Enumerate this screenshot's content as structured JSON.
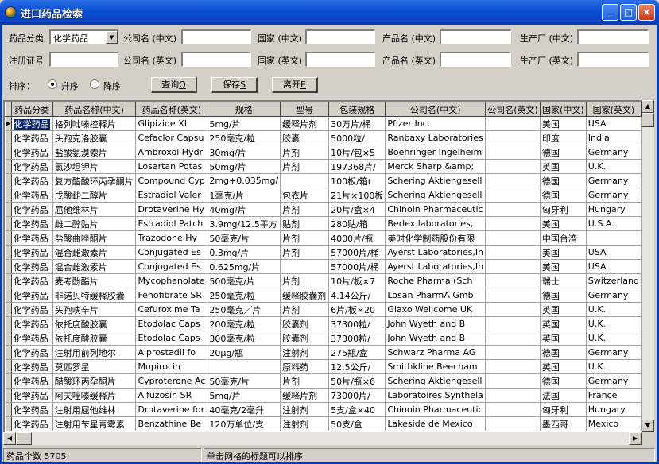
{
  "window": {
    "title": "进口药品检索",
    "minimize": "_",
    "maximize": "□",
    "close": "×"
  },
  "form": {
    "category_label": "药品分类",
    "category_value": "化学药品",
    "company_cn_label": "公司名 (中文)",
    "company_cn_value": "",
    "country_cn_label": "国家 (中文)",
    "country_cn_value": "",
    "product_cn_label": "产品名 (中文)",
    "product_cn_value": "",
    "maker_cn_label": "生产厂 (中文)",
    "maker_cn_value": "",
    "regno_label": "注册证号",
    "regno_value": "",
    "company_en_label": "公司名 (英文)",
    "company_en_value": "",
    "country_en_label": "国家 (英文)",
    "country_en_value": "",
    "product_en_label": "产品名 (英文)",
    "product_en_value": "",
    "maker_en_label": "生产厂 (英文)",
    "maker_en_value": "",
    "sort_label": "排序：",
    "asc_label": "升序",
    "desc_label": "降序",
    "sort_selected": "asc",
    "query_label": "查询",
    "query_key": "Q",
    "save_label": "保存",
    "save_key": "S",
    "exit_label": "离开",
    "exit_key": "E"
  },
  "grid": {
    "columns": [
      "药品分类",
      "药品名称(中文)",
      "药品名称(英文)",
      "规格",
      "型号",
      "包装规格",
      "公司名(中文)",
      "公司名(英文)",
      "国家(中文)",
      "国家(英文)"
    ],
    "rows": [
      [
        "化学药品",
        "格列吡嗪控释片",
        "Glipizide   XL",
        "5mg/片",
        "缓释片剂",
        "30万片/桶",
        "Pfizer   Inc.",
        "",
        "美国",
        "USA"
      ],
      [
        "化学药品",
        "头孢克洛胶囊",
        "Cefaclor   Capsu",
        "250毫克/粒",
        "胶囊",
        "5000粒/",
        "Ranbaxy   Laboratories",
        "",
        "印度",
        "India"
      ],
      [
        "化学药品",
        "盐酸氨溴索片",
        "Ambroxol   Hydr",
        "30mg/片",
        "片剂",
        "10片/包×5",
        "Boehringer   Ingelheim",
        "",
        "德国",
        "Germany"
      ],
      [
        "化学药品",
        "氯沙坦钾片",
        "Losartan   Potas",
        "50mg/片",
        "片剂",
        "197368片/",
        "Merck   Sharp   &amp;",
        "",
        "英国",
        "U.K."
      ],
      [
        "化学药品",
        "复方醋酸环丙孕酮片",
        "Compound   Cyp",
        "2mg+0.035mg/",
        "",
        "100板/箱(",
        "Schering   Aktiengesell",
        "",
        "德国",
        "Germany"
      ],
      [
        "化学药品",
        "戊酸雌二醇片",
        "Estradiol   Valer",
        "1毫克/片",
        "包衣片",
        "21片×100板",
        "Schering   Aktiengesell",
        "",
        "德国",
        "Germany"
      ],
      [
        "化学药品",
        "屈他维林片",
        "Drotaverine   Hy",
        "40mg/片",
        "片剂",
        "20片/盒×4",
        "Chinoin   Pharmaceutic",
        "",
        "匈牙利",
        "Hungary"
      ],
      [
        "化学药品",
        "雌二醇贴片",
        "Estradiol   Patch",
        "3.9mg/12.5平方",
        "贴剂",
        "280贴/箱",
        "Berlex   laboratories,",
        "",
        "美国",
        "U.S.A."
      ],
      [
        "化学药品",
        "盐酸曲唑酮片",
        "Trazodone   Hy",
        "50毫克/片",
        "片剂",
        "4000片/瓶",
        "美时化学制药股份有限",
        "",
        "中国台湾",
        ""
      ],
      [
        "化学药品",
        "混合雌激素片",
        "Conjugated   Es",
        "0.3mg/片",
        "片剂",
        "57000片/桶",
        "Ayerst   Laboratories,In",
        "",
        "美国",
        "USA"
      ],
      [
        "化学药品",
        "混合雌激素片",
        "Conjugated   Es",
        "0.625mg/片",
        "",
        "57000片/桶",
        "Ayerst   Laboratories,In",
        "",
        "美国",
        "USA"
      ],
      [
        "化学药品",
        "麦考酚酯片",
        "Mycophenolate",
        "500毫克/片",
        "片剂",
        "10片/板×7",
        "Roche   Pharma   (Sch",
        "",
        "瑞士",
        "Switzerland"
      ],
      [
        "化学药品",
        "非诺贝特缓释胶囊",
        "Fenofibrate   SR",
        "250毫克/粒",
        "缓释胶囊剂",
        "4.14公斤/",
        "Losan   PharmA   Gmb",
        "",
        "德国",
        "Germany"
      ],
      [
        "化学药品",
        "头孢呋辛片",
        "Cefuroxime   Ta",
        "250毫克／片",
        "片剂",
        "6片/板×20",
        "Glaxo   Wellcome   UK",
        "",
        "英国",
        "U.K."
      ],
      [
        "化学药品",
        "依托度酸胶囊",
        "Etodolac   Caps",
        "200毫克/粒",
        "胶囊剂",
        "37300粒/",
        "John   Wyeth   and   B",
        "",
        "英国",
        "U.K."
      ],
      [
        "化学药品",
        "依托度酸胶囊",
        "Etodolac   Caps",
        "300毫克/粒",
        "胶囊剂",
        "37300粒/",
        "John   Wyeth   and   B",
        "",
        "英国",
        "U.K."
      ],
      [
        "化学药品",
        "注射用前列地尔",
        "Alprostadil   fo",
        "20μg/瓶",
        "注射剂",
        "275瓶/盒",
        "Schwarz   Pharma   AG",
        "",
        "德国",
        "Germany"
      ],
      [
        "化学药品",
        "莫匹罗星",
        "Mupirocin",
        "",
        "原料药",
        "12.5公斤/",
        "Smithkline   Beecham",
        "",
        "英国",
        "U.K."
      ],
      [
        "化学药品",
        "醋酸环丙孕酮片",
        "Cyproterone   Ac",
        "50毫克/片",
        "片剂",
        "50片/瓶×6",
        "Schering   Aktiengesell",
        "",
        "德国",
        "Germany"
      ],
      [
        "化学药品",
        "阿夫唑嗪缓释片",
        "Alfuzosin   SR",
        "5mg/片",
        "缓释片剂",
        "73000片/",
        "Laboratoires   Synthela",
        "",
        "法国",
        "France"
      ],
      [
        "化学药品",
        "注射用屈他维林",
        "Drotaverine   for",
        "40毫克/2毫升",
        "注射剂",
        "5支/盒×40",
        "Chinoin   Pharmaceutic",
        "",
        "匈牙利",
        "Hungary"
      ],
      [
        "化学药品",
        "注射用苄星青霉素",
        "Benzathine   Be",
        "120万单位/支",
        "注射剂",
        "50支/盒",
        "Lakeside   de   Mexico",
        "",
        "墨西哥",
        "Mexico"
      ]
    ]
  },
  "status": {
    "count_label": "药品个数",
    "count_value": "5705",
    "hint": "单击网格的标题可以排序"
  }
}
